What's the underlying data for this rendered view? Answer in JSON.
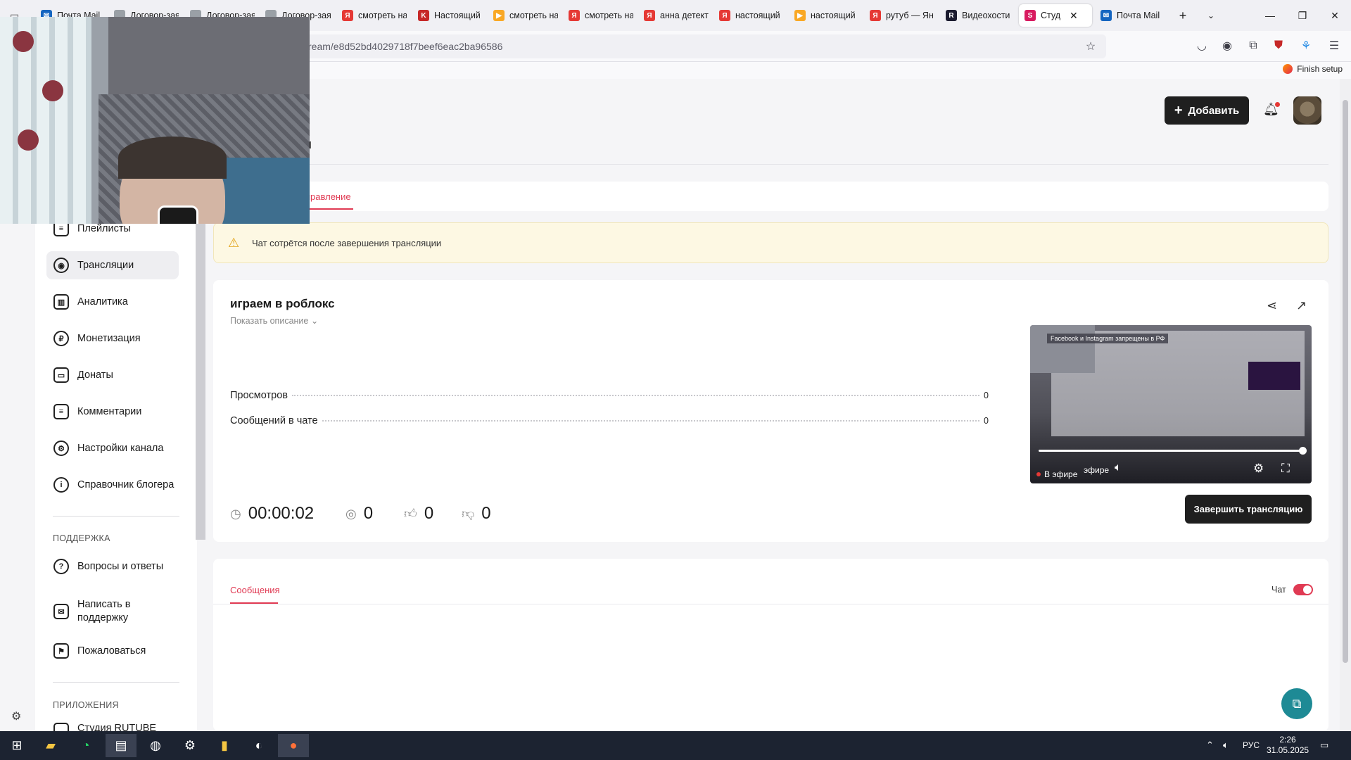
{
  "browser": {
    "tabs": [
      {
        "label": "Почта Mail",
        "color": "#1565c0",
        "glyph": "✉"
      },
      {
        "label": "Договор-заявк",
        "color": "#9aa0a6",
        "glyph": ""
      },
      {
        "label": "Договор-заявк",
        "color": "#9aa0a6",
        "glyph": ""
      },
      {
        "label": "Договор-заявк",
        "color": "#9aa0a6",
        "glyph": ""
      },
      {
        "label": "смотреть на",
        "color": "#e53935",
        "glyph": "Я"
      },
      {
        "label": "Настоящий",
        "color": "#c62828",
        "glyph": "K"
      },
      {
        "label": "смотреть на",
        "color": "#f9a825",
        "glyph": "▶"
      },
      {
        "label": "смотреть на",
        "color": "#e53935",
        "glyph": "Я"
      },
      {
        "label": "анна детект",
        "color": "#e53935",
        "glyph": "Я"
      },
      {
        "label": "настоящий",
        "color": "#e53935",
        "glyph": "Я"
      },
      {
        "label": "настоящий",
        "color": "#f9a825",
        "glyph": "▶"
      },
      {
        "label": "рутуб — Ян",
        "color": "#e53935",
        "glyph": "Я"
      },
      {
        "label": "Видеохости",
        "color": "#1a1a2e",
        "glyph": "R"
      },
      {
        "label": "Студ",
        "color": "#d81b60",
        "glyph": "S"
      },
      {
        "label": "Почта Mail",
        "color": "#1565c0",
        "glyph": "✉"
      }
    ],
    "url": "ream/e8d52bd4029718f7beef6eac2ba96586",
    "finish_setup": "Finish setup"
  },
  "header": {
    "add_label": "Добавить",
    "title_tail": "н",
    "tab_manage": "правление"
  },
  "sidebar": {
    "items": [
      {
        "label": "Плейлисты",
        "icon": "list-icon"
      },
      {
        "label": "Трансляции",
        "icon": "broadcast-icon"
      },
      {
        "label": "Аналитика",
        "icon": "analytics-icon"
      },
      {
        "label": "Монетизация",
        "icon": "ruble-icon"
      },
      {
        "label": "Донаты",
        "icon": "wallet-icon"
      },
      {
        "label": "Комментарии",
        "icon": "comment-icon"
      },
      {
        "label": "Настройки канала",
        "icon": "gear-icon"
      },
      {
        "label": "Справочник блогера",
        "icon": "info-icon"
      }
    ],
    "support_heading": "ПОДДЕРЖКА",
    "support_items": [
      {
        "label": "Вопросы и ответы",
        "icon": "question-icon"
      },
      {
        "label": "Написать в поддержку",
        "icon": "mail-icon"
      },
      {
        "label": "Пожаловаться",
        "icon": "flag-icon"
      }
    ],
    "apps_heading": "ПРИЛОЖЕНИЯ",
    "apps_partial": "Студия RUTUBE"
  },
  "warning": {
    "text": "Чат сотрётся после завершения трансляции"
  },
  "stream": {
    "title": "играем в роблокс",
    "show_description": "Показать описание",
    "stats": [
      {
        "label": "Просмотров",
        "value": "0"
      },
      {
        "label": "Сообщений в чате",
        "value": "0"
      }
    ],
    "duration": "00:00:02",
    "viewers": "0",
    "likes": "0",
    "dislikes": "0",
    "end_button": "Завершить трансляцию",
    "player": {
      "banner": "Facebook и Instagram запрещены в РФ",
      "live_label": "В эфире",
      "live_label2": "эфире",
      "progress": 1.0
    }
  },
  "chat": {
    "tab_label": "Сообщения",
    "toggle_label": "Чат",
    "toggle_on": true
  },
  "taskbar": {
    "lang": "РУС",
    "time": "2:26",
    "date": "31.05.2025"
  }
}
